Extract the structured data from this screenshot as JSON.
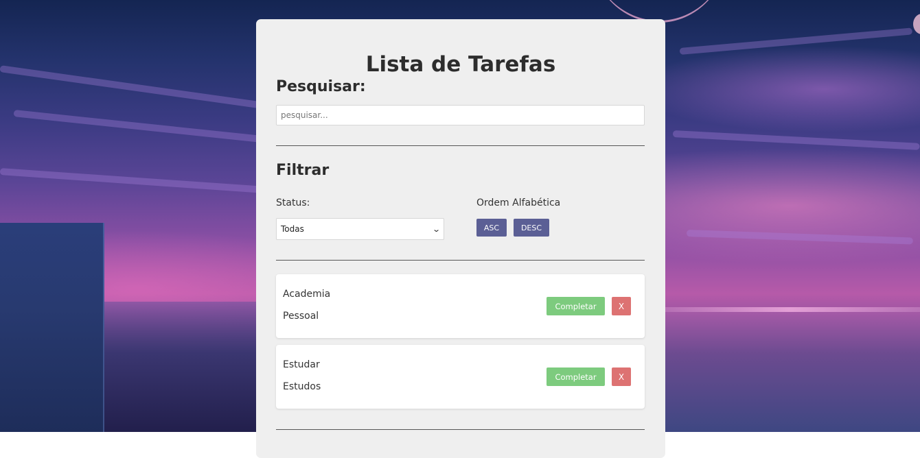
{
  "app": {
    "title": "Lista de Tarefas"
  },
  "search": {
    "heading": "Pesquisar:",
    "placeholder": "pesquisar...",
    "value": ""
  },
  "filter": {
    "heading": "Filtrar",
    "status_label": "Status:",
    "status_selected": "Todas",
    "sort_label": "Ordem Alfabética",
    "asc_label": "ASC",
    "desc_label": "DESC"
  },
  "todos": [
    {
      "text": "Academia",
      "category": "Pessoal",
      "complete_label": "Completar",
      "delete_label": "X"
    },
    {
      "text": "Estudar",
      "category": "Estudos",
      "complete_label": "Completar",
      "delete_label": "X"
    }
  ],
  "colors": {
    "card_background": "#efefef",
    "sort_button": "#5b5f95",
    "complete_button": "#7dcb7e",
    "delete_button": "#dd7272"
  }
}
